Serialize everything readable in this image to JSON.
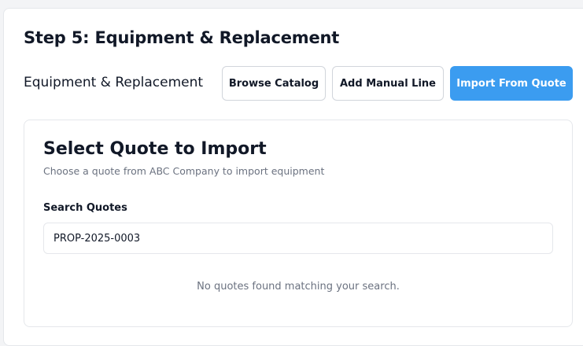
{
  "step": {
    "title": "Step 5: Equipment & Replacement"
  },
  "section": {
    "title": "Equipment & Replacement",
    "buttons": {
      "browse_catalog": "Browse Catalog",
      "add_manual_line": "Add Manual Line",
      "import_from_quote": "Import From Quote"
    }
  },
  "import_panel": {
    "title": "Select Quote to Import",
    "subtitle": "Choose a quote from ABC Company to import equipment",
    "search": {
      "label": "Search Quotes",
      "value": "PROP-2025-0003"
    },
    "empty_message": "No quotes found matching your search."
  },
  "colors": {
    "primary": "#3b9cf0",
    "border": "#e5e7eb",
    "muted_text": "#6b7280"
  }
}
